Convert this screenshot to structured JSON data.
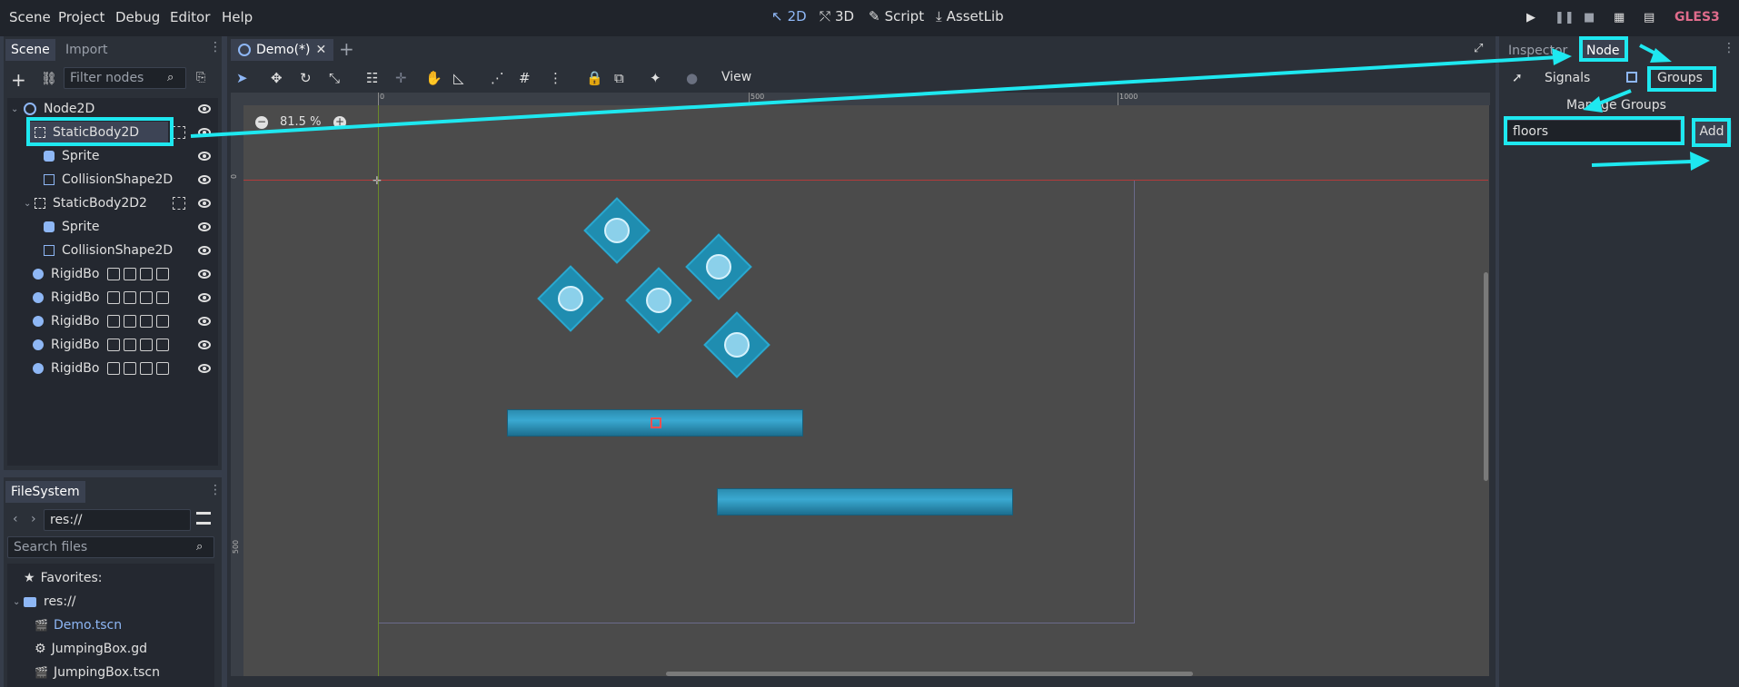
{
  "menubar": {
    "menus": [
      "Scene",
      "Project",
      "Debug",
      "Editor",
      "Help"
    ],
    "modes": [
      "2D",
      "3D",
      "Script",
      "AssetLib"
    ],
    "renderer": "GLES3"
  },
  "scene_dock": {
    "tabs": [
      "Scene",
      "Import"
    ],
    "filter_placeholder": "Filter nodes",
    "tree": [
      "Node2D",
      "StaticBody2D",
      "Sprite",
      "CollisionShape2D",
      "StaticBody2D2",
      "Sprite",
      "CollisionShape2D",
      "RigidBo",
      "RigidBo",
      "RigidBo",
      "RigidBo",
      "RigidBo"
    ]
  },
  "filesystem_dock": {
    "tab": "FileSystem",
    "path": "res://",
    "search_placeholder": "Search files",
    "favorites_label": "Favorites:",
    "root": "res://",
    "files": [
      "Demo.tscn",
      "JumpingBox.gd",
      "JumpingBox.tscn"
    ]
  },
  "editor": {
    "scene_tab": "Demo(*)",
    "view_menu": "View",
    "zoom": "81.5 %",
    "ruler_labels": [
      "0",
      "500",
      "1000"
    ],
    "ruler_left_labels": [
      "0",
      "500"
    ]
  },
  "right_dock": {
    "tabs": [
      "Inspector",
      "Node"
    ],
    "subtabs": [
      "Signals",
      "Groups"
    ],
    "manage_groups": "Manage Groups",
    "group_input": "floors",
    "add_button": "Add"
  },
  "colors": {
    "accent": "#1ee8f0",
    "active_mode": "#8eb7f5",
    "renderer": "#e06c8c",
    "scene_file": "#8eb7f5"
  }
}
